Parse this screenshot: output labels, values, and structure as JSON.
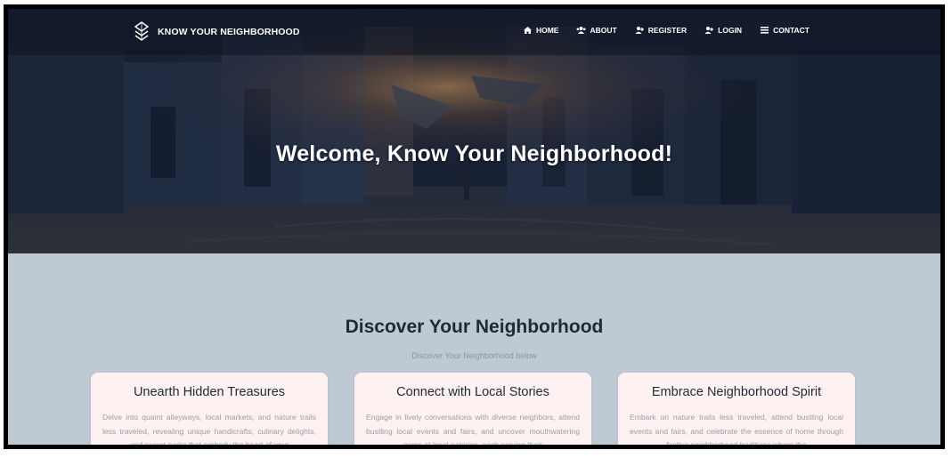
{
  "brand": {
    "name": "KNOW YOUR NEIGHBORHOOD",
    "icon": "diamond-stack-logo"
  },
  "nav": [
    {
      "label": "HOME",
      "icon": "home-icon"
    },
    {
      "label": "ABOUT",
      "icon": "users-icon"
    },
    {
      "label": "REGISTER",
      "icon": "user-plus-icon"
    },
    {
      "label": "LOGIN",
      "icon": "user-login-icon"
    },
    {
      "label": "CONTACT",
      "icon": "list-icon"
    }
  ],
  "hero": {
    "title": "Welcome, Know Your Neighborhood!"
  },
  "section": {
    "title": "Discover Your Neighborhood",
    "subtitle": "Discover Your Neighborhood below"
  },
  "cards": [
    {
      "title": "Unearth Hidden Treasures",
      "text": "Delve into quaint alleyways, local markets, and nature trails less traveled, revealing unique handicrafts, culinary delights, and secret parks that embody the heart of your"
    },
    {
      "title": "Connect with Local Stories",
      "text": "Engage in lively conversations with diverse neighbors, attend bustling local events and fairs, and uncover mouthwatering gems at local eateries, each serving their"
    },
    {
      "title": "Embrace Neighborhood Spirit",
      "text": "Embark on nature trails less traveled, attend bustling local events and fairs, and celebrate the essence of home through festive neighborhood traditions where the"
    }
  ],
  "colors": {
    "section_bg": "#bfc9d4",
    "card_bg": "#fdf1f1",
    "hero_overlay": "#1a2233"
  }
}
